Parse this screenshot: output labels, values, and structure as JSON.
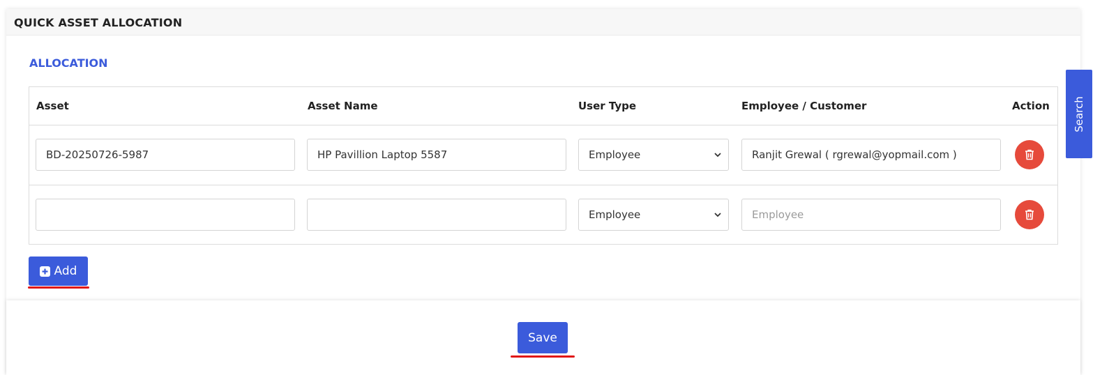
{
  "header": {
    "title": "QUICK ASSET ALLOCATION"
  },
  "section": {
    "title": "ALLOCATION"
  },
  "table": {
    "columns": [
      "Asset",
      "Asset Name",
      "User Type",
      "Employee / Customer",
      "Action"
    ],
    "rows": [
      {
        "asset": "BD-20250726-5987",
        "asset_name": "HP Pavillion Laptop 5587",
        "user_type": "Employee",
        "person": "Ranjit Grewal ( rgrewal@yopmail.com )"
      },
      {
        "asset": "",
        "asset_name": "",
        "user_type": "Employee",
        "person_placeholder": "Employee"
      }
    ]
  },
  "buttons": {
    "add_label": "Add",
    "save_label": "Save"
  },
  "side_tab": {
    "label": "Search"
  },
  "colors": {
    "primary": "#3b5bdb",
    "danger": "#e64a3b",
    "underline": "#e01515"
  }
}
